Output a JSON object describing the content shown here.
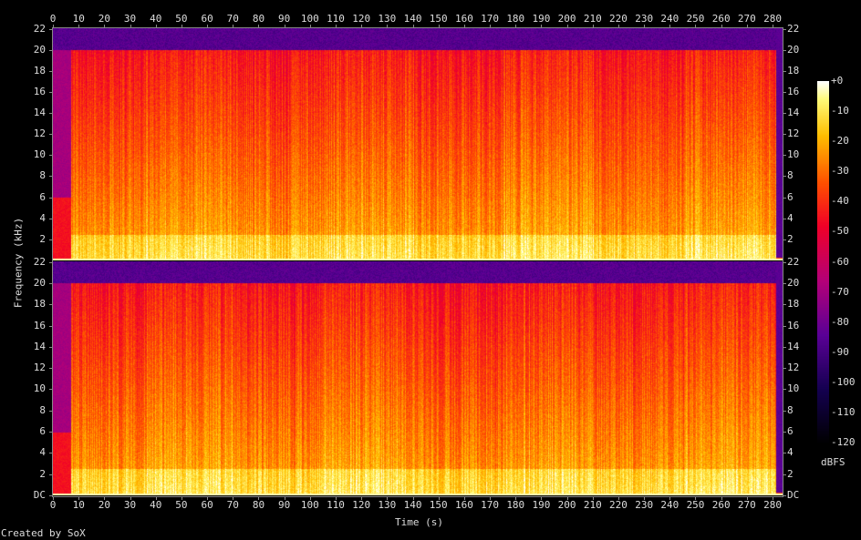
{
  "chart_data": {
    "type": "heatmap",
    "title": "",
    "xlabel": "Time (s)",
    "ylabel": "Frequency (kHz)",
    "xlim": [
      0,
      283.5
    ],
    "ylim": [
      0,
      22.05
    ],
    "x_ticks": [
      "0",
      "10",
      "20",
      "30",
      "40",
      "50",
      "60",
      "70",
      "80",
      "90",
      "100",
      "110",
      "120",
      "130",
      "140",
      "150",
      "160",
      "170",
      "180",
      "190",
      "200",
      "210",
      "220",
      "230",
      "240",
      "250",
      "260",
      "270",
      "280"
    ],
    "y_ticks": [
      "DC",
      "2",
      "4",
      "6",
      "8",
      "10",
      "12",
      "14",
      "16",
      "18",
      "20",
      "22"
    ],
    "channels": 2,
    "colorbar": {
      "label": "dBFS",
      "range": [
        -120,
        0
      ],
      "ticks": [
        "+0",
        "-10",
        "-20",
        "-30",
        "-40",
        "-50",
        "-60",
        "-70",
        "-80",
        "-90",
        "-100",
        "-110",
        "-120"
      ]
    },
    "description_levels": {
      "lowpass_cutoff_khz": 20,
      "intro_quiet_until_s": 7,
      "silence_after_s": 281
    }
  },
  "footer": {
    "credit": "Created by SoX"
  }
}
